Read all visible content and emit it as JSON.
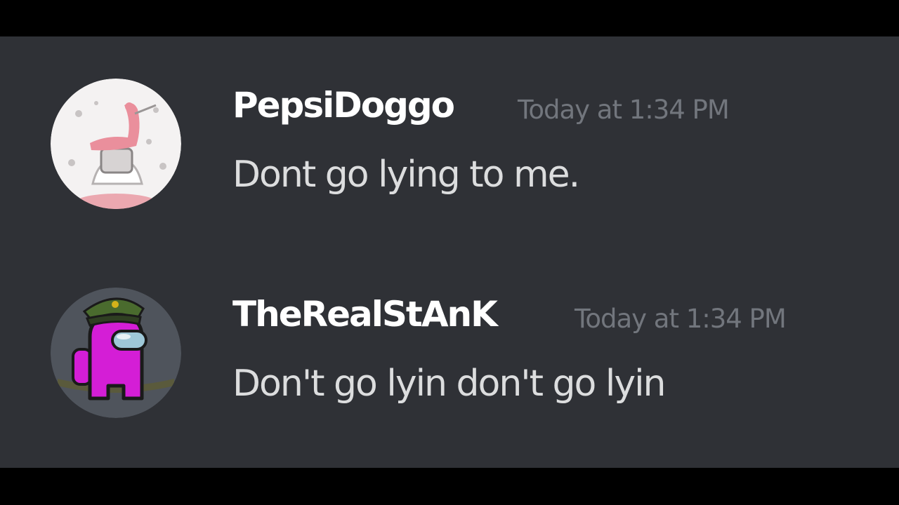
{
  "messages": [
    {
      "username": "PepsiDoggo",
      "timestamp": "Today at 1:34 PM",
      "text": "Dont go lying to me.",
      "avatar": "sketch-creature-avatar"
    },
    {
      "username": "TheRealStAnK",
      "timestamp": "Today at 1:34 PM",
      "text": "Don't go lyin don't go lyin",
      "avatar": "magenta-crewmate-avatar"
    }
  ],
  "colors": {
    "background": "#2f3136",
    "letterbox": "#000000",
    "username": "#ffffff",
    "timestamp": "#72767d",
    "message_text": "#dcddde",
    "crewmate": "#d41ed6"
  }
}
